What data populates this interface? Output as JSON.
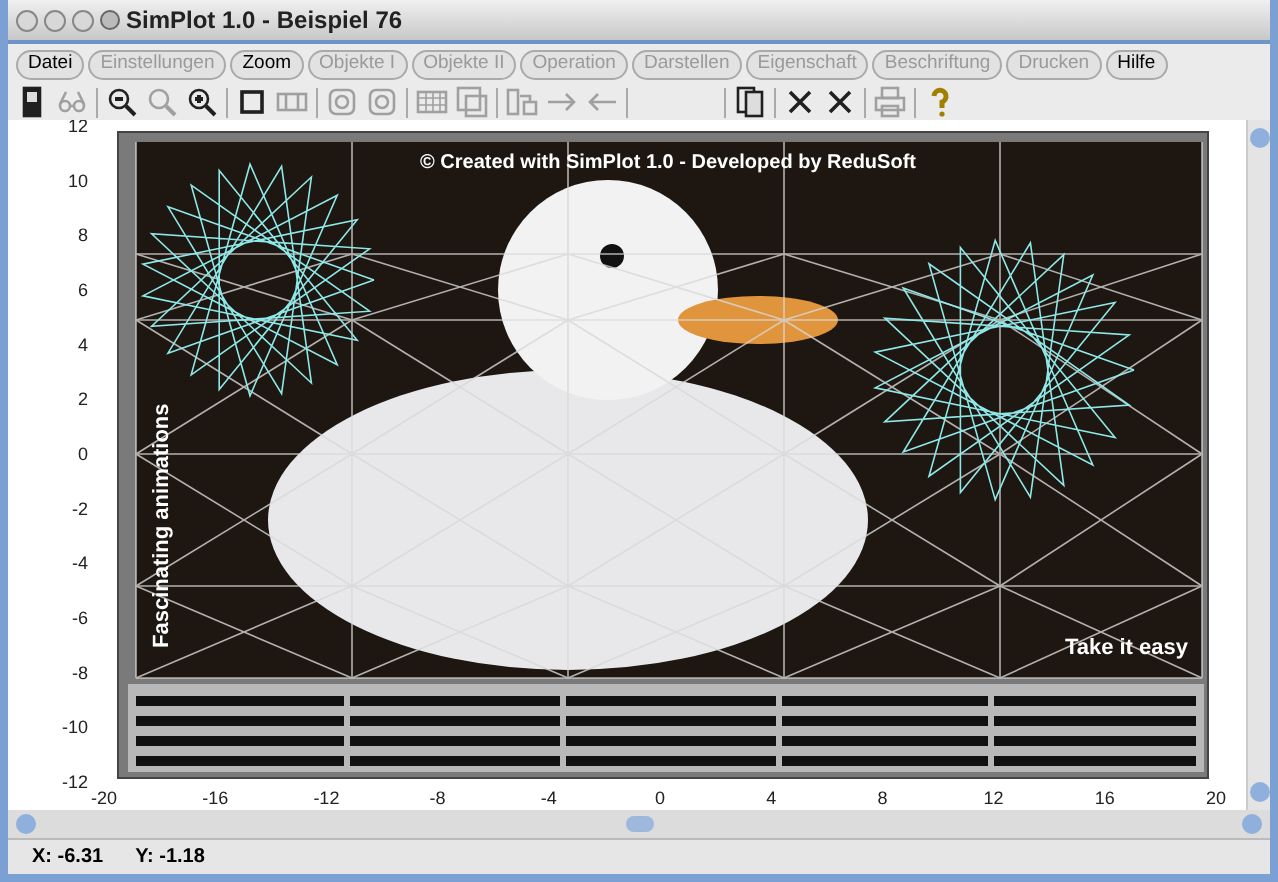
{
  "window": {
    "title": "SimPlot 1.0 - Beispiel 76"
  },
  "menu": [
    {
      "label": "Datei",
      "disabled": false
    },
    {
      "label": "Einstellungen",
      "disabled": true
    },
    {
      "label": "Zoom",
      "disabled": false
    },
    {
      "label": "Objekte I",
      "disabled": true
    },
    {
      "label": "Objekte II",
      "disabled": true
    },
    {
      "label": "Operation",
      "disabled": true
    },
    {
      "label": "Darstellen",
      "disabled": true
    },
    {
      "label": "Eigenschaft",
      "disabled": true
    },
    {
      "label": "Beschriftung",
      "disabled": true
    },
    {
      "label": "Drucken",
      "disabled": true
    },
    {
      "label": "Hilfe",
      "disabled": false
    }
  ],
  "toolbar": [
    {
      "kind": "device",
      "disabled": false
    },
    {
      "kind": "glasses",
      "disabled": true
    },
    {
      "kind": "separator"
    },
    {
      "kind": "zoom-out",
      "disabled": false
    },
    {
      "kind": "zoom",
      "disabled": true
    },
    {
      "kind": "zoom-in",
      "disabled": false
    },
    {
      "kind": "separator"
    },
    {
      "kind": "square",
      "disabled": false
    },
    {
      "kind": "frame",
      "disabled": true
    },
    {
      "kind": "separator"
    },
    {
      "kind": "circle",
      "disabled": true
    },
    {
      "kind": "circle",
      "disabled": true
    },
    {
      "kind": "separator"
    },
    {
      "kind": "table",
      "disabled": true
    },
    {
      "kind": "image",
      "disabled": true
    },
    {
      "kind": "separator"
    },
    {
      "kind": "swap",
      "disabled": true
    },
    {
      "kind": "arrow-right",
      "disabled": true
    },
    {
      "kind": "arrow-left",
      "disabled": true
    },
    {
      "kind": "separator"
    },
    {
      "kind": "gap"
    },
    {
      "kind": "separator"
    },
    {
      "kind": "pages",
      "disabled": false
    },
    {
      "kind": "separator"
    },
    {
      "kind": "cross",
      "disabled": false
    },
    {
      "kind": "cross",
      "disabled": false
    },
    {
      "kind": "separator"
    },
    {
      "kind": "printer",
      "disabled": true
    },
    {
      "kind": "separator"
    },
    {
      "kind": "help",
      "disabled": false
    }
  ],
  "plot": {
    "y_ticks": [
      "12",
      "10",
      "8",
      "6",
      "4",
      "2",
      "0",
      "-2",
      "-4",
      "-6",
      "-8",
      "-10",
      "-12"
    ],
    "x_ticks": [
      "-20",
      "-16",
      "-12",
      "-8",
      "-4",
      "0",
      "4",
      "8",
      "12",
      "16",
      "20"
    ],
    "image": {
      "caption": "© Created with SimPlot 1.0 - Developed by ReduSoft",
      "side_text": "Fascinating animations",
      "corner_text": "Take it easy"
    }
  },
  "status_bar": {
    "x": "X: -6.31",
    "y": "Y: -1.18"
  }
}
